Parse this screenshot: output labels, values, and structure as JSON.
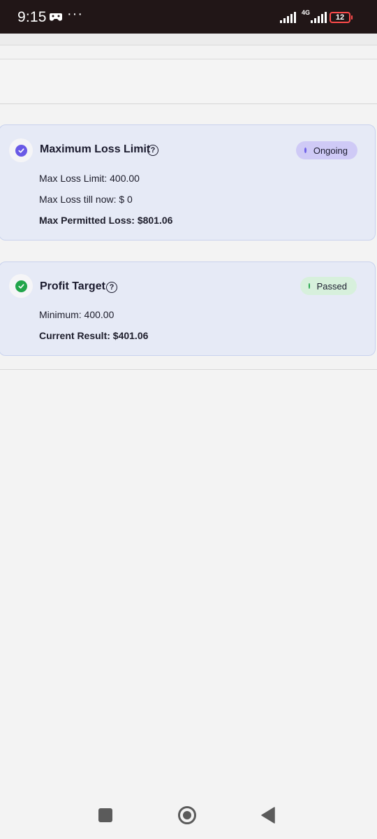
{
  "status_bar": {
    "time": "9:15",
    "more": "···",
    "network": "4G",
    "battery": "12"
  },
  "cards": {
    "max_loss": {
      "title": "Maximum Loss Limit",
      "status": "Ongoing",
      "status_color": "#6f61e8",
      "rows": [
        "Max Loss Limit: 400.00",
        "Max Loss till now: $ 0",
        "Max Permitted Loss: $801.06"
      ]
    },
    "profit_target": {
      "title": "Profit Target",
      "status": "Passed",
      "status_color": "#22a54a",
      "rows": [
        "Minimum: 400.00",
        "Current Result: $401.06"
      ]
    }
  },
  "icons": {
    "check": "check-icon",
    "help": "question-mark-icon",
    "nav": [
      "recent-apps-icon",
      "home-icon",
      "back-icon"
    ]
  },
  "help_glyph": "?"
}
